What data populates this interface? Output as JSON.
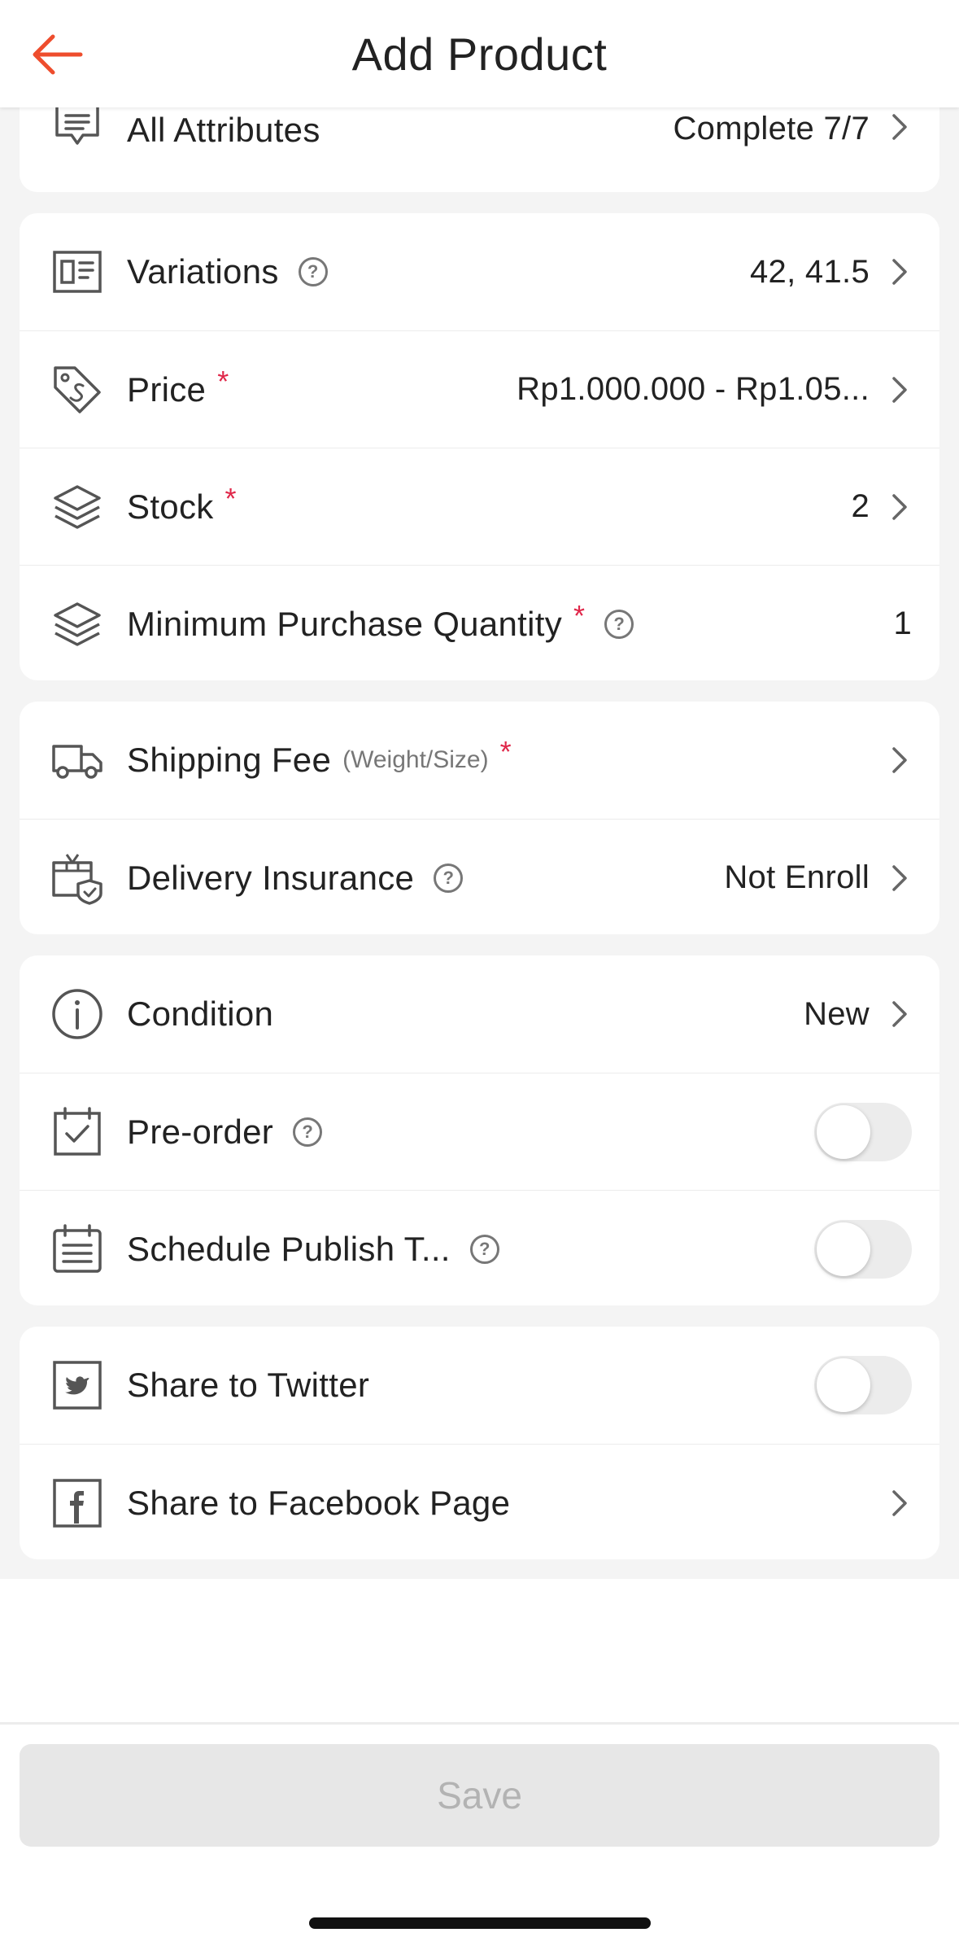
{
  "header": {
    "title": "Add Product"
  },
  "sections": [
    {
      "rows": [
        {
          "label": "All Attributes",
          "value": "Complete 7/7"
        }
      ]
    },
    {
      "rows": [
        {
          "label": "Variations",
          "value": "42, 41.5"
        },
        {
          "label": "Price",
          "required": "*",
          "value": "Rp1.000.000 - Rp1.05..."
        },
        {
          "label": "Stock",
          "required": "*",
          "value": "2"
        },
        {
          "label": "Minimum Purchase Quantity",
          "required": "*",
          "value": "1"
        }
      ]
    },
    {
      "rows": [
        {
          "label": "Shipping Fee",
          "sub": "(Weight/Size)",
          "required": "*"
        },
        {
          "label": "Delivery Insurance",
          "value": "Not Enroll"
        }
      ]
    },
    {
      "rows": [
        {
          "label": "Condition",
          "value": "New"
        },
        {
          "label": "Pre-order",
          "toggle": false
        },
        {
          "label": "Schedule Publish T...",
          "toggle": false
        }
      ]
    },
    {
      "rows": [
        {
          "label": "Share to Twitter",
          "toggle": false
        },
        {
          "label": "Share to Facebook Page"
        }
      ]
    }
  ],
  "help_glyph": "?",
  "footer": {
    "save_label": "Save"
  },
  "colors": {
    "accent": "#ee4d2d",
    "required": "#e0284a",
    "background": "#f4f4f4",
    "disabled_button": "#e7e7e7"
  }
}
